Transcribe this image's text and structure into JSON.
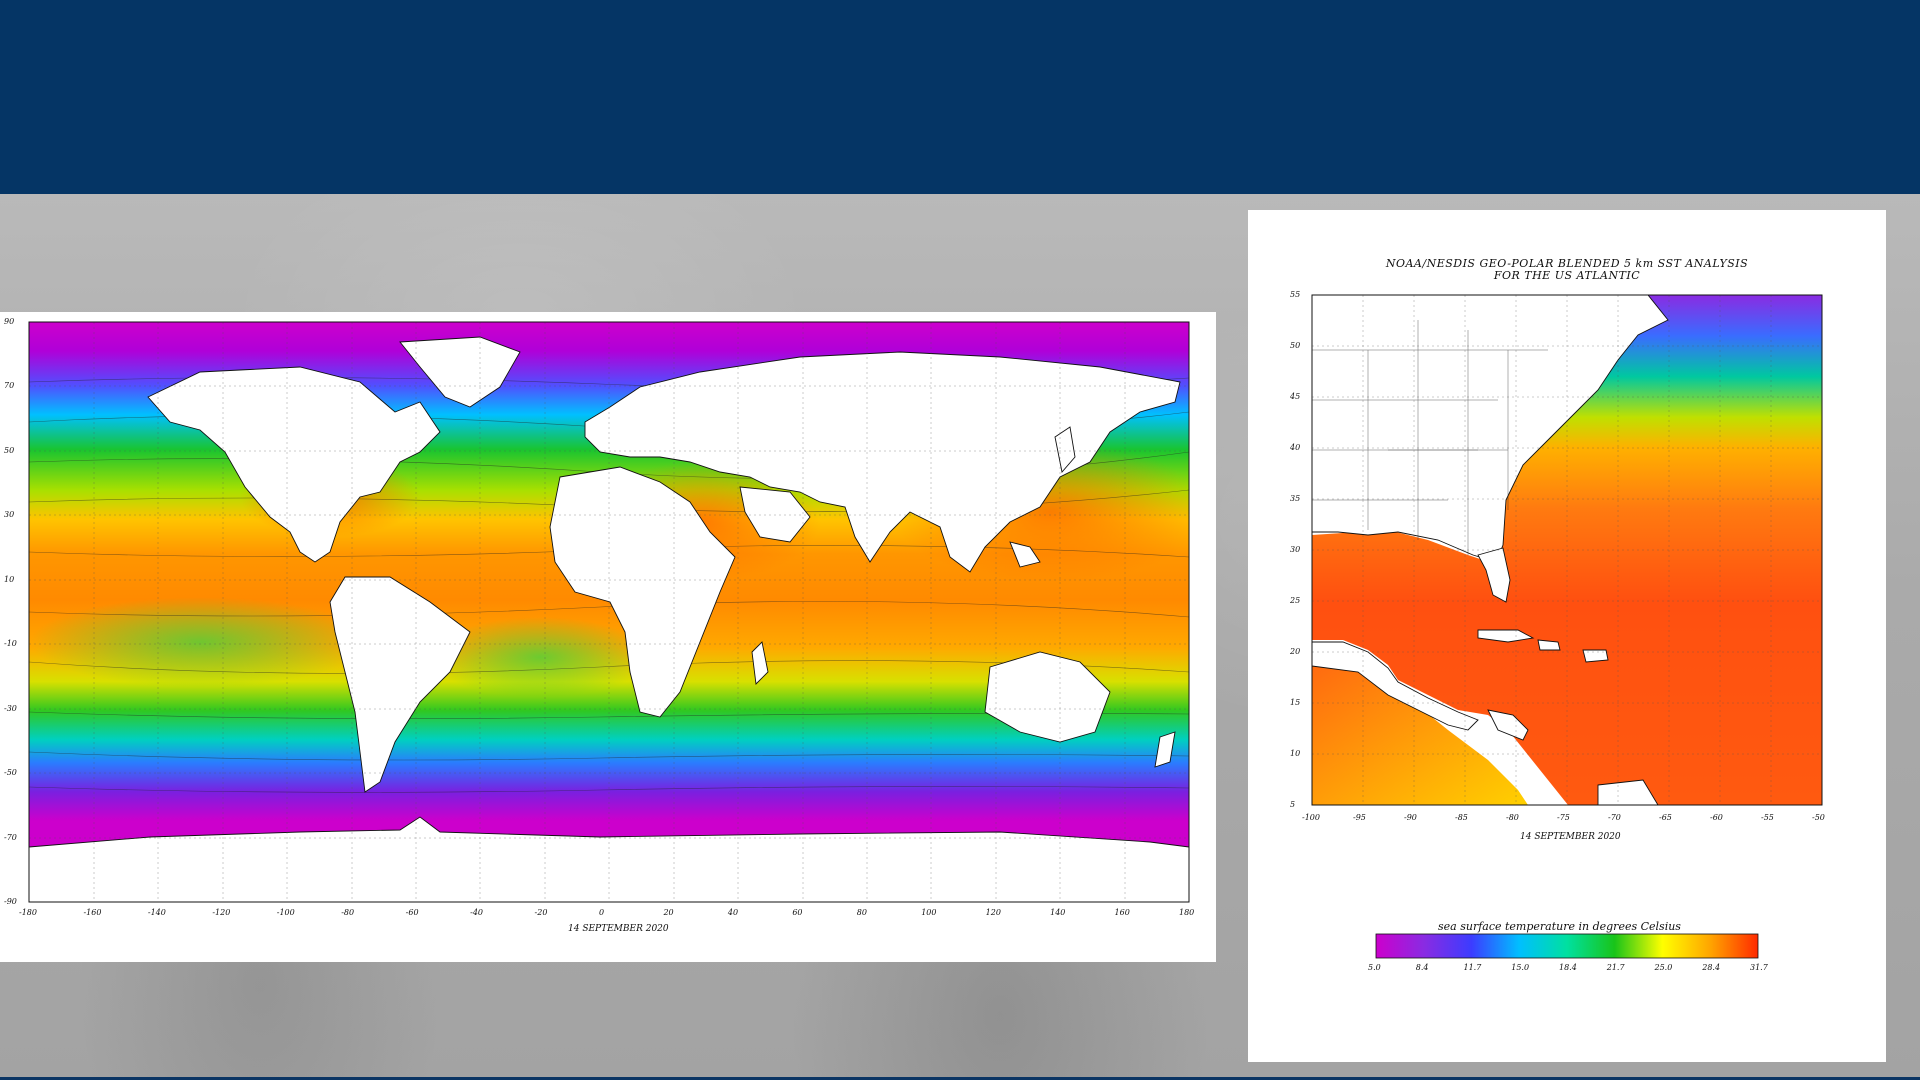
{
  "slide": {
    "header_text": ""
  },
  "global_map": {
    "date": "14 SEPTEMBER 2020",
    "lon_ticks": [
      "-180",
      "-160",
      "-140",
      "-120",
      "-100",
      "-80",
      "-60",
      "-40",
      "-20",
      "0",
      "20",
      "40",
      "60",
      "80",
      "100",
      "120",
      "140",
      "160",
      "180"
    ],
    "lat_ticks": [
      "90",
      "70",
      "50",
      "30",
      "10",
      "-10",
      "-30",
      "-50",
      "-70",
      "-90"
    ]
  },
  "atlantic_map": {
    "title_line1": "NOAA/NESDIS GEO-POLAR BLENDED 5 km SST ANALYSIS",
    "title_line2": "FOR THE US ATLANTIC",
    "date": "14 SEPTEMBER 2020",
    "lon_ticks": [
      "-100",
      "-95",
      "-90",
      "-85",
      "-80",
      "-75",
      "-70",
      "-65",
      "-60",
      "-55",
      "-50"
    ],
    "lat_ticks": [
      "55",
      "50",
      "45",
      "40",
      "35",
      "30",
      "25",
      "20",
      "15",
      "10",
      "5"
    ]
  },
  "colorbar": {
    "label": "sea surface temperature in degrees Celsius",
    "ticks": [
      "5.0",
      "8.4",
      "11.7",
      "15.0",
      "18.4",
      "21.7",
      "25.0",
      "28.4",
      "31.7"
    ],
    "colors": [
      "#cc00cc",
      "#8a2be2",
      "#3c3cff",
      "#00bfff",
      "#00e0a0",
      "#19c419",
      "#ffff00",
      "#ffa500",
      "#ff2a00"
    ]
  }
}
